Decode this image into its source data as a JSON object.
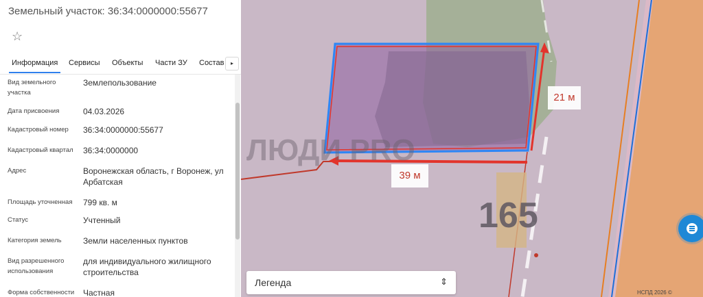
{
  "panel": {
    "title": "Земельный участок: 36:34:0000000:55677",
    "star_icon": "☆",
    "tabs": [
      "Информация",
      "Сервисы",
      "Объекты",
      "Части ЗУ",
      "Состав"
    ],
    "tab_next_icon": "▸",
    "properties": [
      {
        "label": "Вид земельного участка",
        "value": "Землепользование"
      },
      {
        "label": "Дата присвоения",
        "value": "04.03.2026"
      },
      {
        "label": "Кадастровый номер",
        "value": "36:34:0000000:55677"
      },
      {
        "label": "Кадастровый квартал",
        "value": "36:34:0000000"
      },
      {
        "label": "Адрес",
        "value": "Воронежская область, г Воронеж, ул Арбатская"
      },
      {
        "label": "Площадь уточненная",
        "value": "799 кв. м"
      },
      {
        "label": "Статус",
        "value": "Учтенный"
      },
      {
        "label": "Категория земель",
        "value": "Земли населенных пунктов"
      },
      {
        "label": "Вид разрешенного использования",
        "value": "для индивидуального жилищного строительства"
      },
      {
        "label": "Форма собственности",
        "value": "Частная"
      }
    ]
  },
  "map": {
    "watermark": "ЛЮДИ PRO",
    "house_number": "165",
    "dimension_width": "21 м",
    "dimension_length": "39 м",
    "legend_label": "Легенда",
    "legend_chevron": "⌃⌄",
    "credit": "НСПД 2026 ©"
  }
}
